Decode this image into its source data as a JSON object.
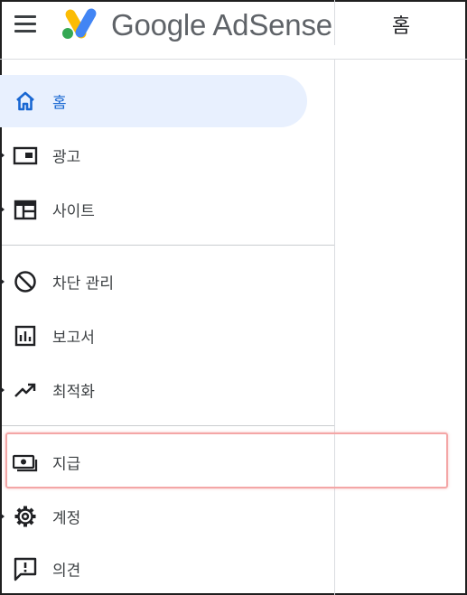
{
  "header": {
    "logo_text": "Google AdSense",
    "page_title": "홈"
  },
  "sidebar": {
    "items": [
      {
        "id": "home",
        "label": "홈",
        "icon": "home-icon",
        "active": true,
        "expandable": false
      },
      {
        "id": "ads",
        "label": "광고",
        "icon": "ads-icon",
        "active": false,
        "expandable": true
      },
      {
        "id": "sites",
        "label": "사이트",
        "icon": "sites-icon",
        "active": false,
        "expandable": true
      },
      {
        "id": "blocking",
        "label": "차단 관리",
        "icon": "block-icon",
        "active": false,
        "expandable": true
      },
      {
        "id": "reports",
        "label": "보고서",
        "icon": "report-icon",
        "active": false,
        "expandable": false
      },
      {
        "id": "optimize",
        "label": "최적화",
        "icon": "trending-up-icon",
        "active": false,
        "expandable": true
      },
      {
        "id": "payments",
        "label": "지급",
        "icon": "payments-icon",
        "active": false,
        "expandable": false,
        "highlighted": true
      },
      {
        "id": "account",
        "label": "계정",
        "icon": "settings-icon",
        "active": false,
        "expandable": true
      },
      {
        "id": "feedback",
        "label": "의견",
        "icon": "feedback-icon",
        "active": false,
        "expandable": false
      }
    ]
  },
  "colors": {
    "active_background": "#e8f0fe",
    "active_text": "#1967d2",
    "icon": "#202124",
    "highlight_border": "#f4a6a6",
    "logo_blue": "#4285f4",
    "logo_yellow": "#fbbc04",
    "logo_green": "#34a853"
  }
}
